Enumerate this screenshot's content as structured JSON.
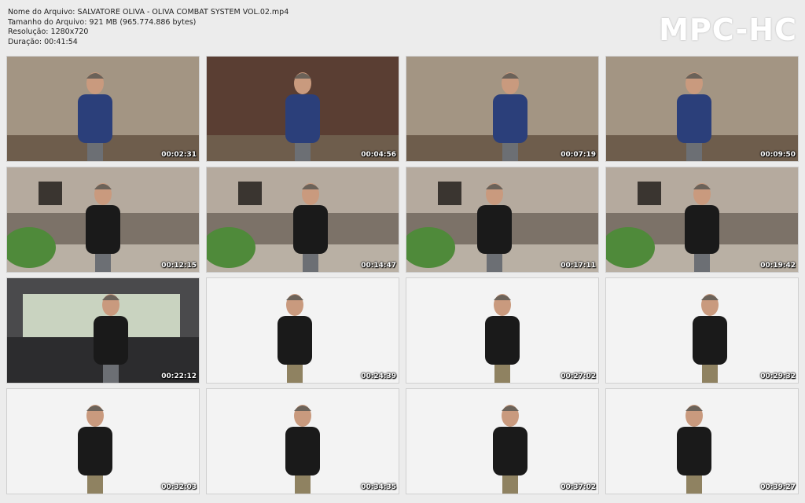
{
  "file_info": {
    "name": "Nome do Arquivo: SALVATORE OLIVA - OLIVA COMBAT SYSTEM VOL.02.mp4",
    "size": "Tamanho do Arquivo: 921 MB (965.774.886 bytes)",
    "resolution": "Resolução: 1280x720",
    "duration": "Duração: 00:41:54"
  },
  "logo": "MPC-HC",
  "colors": {
    "page_background": "#ececec",
    "timestamp_text": "#ffffff"
  },
  "thumbnails": [
    {
      "timestamp": "00:02:31",
      "scene": "indoor-room"
    },
    {
      "timestamp": "00:04:56",
      "scene": "indoor-studio"
    },
    {
      "timestamp": "00:07:19",
      "scene": "indoor-room"
    },
    {
      "timestamp": "00:09:50",
      "scene": "indoor-room"
    },
    {
      "timestamp": "00:12:15",
      "scene": "outdoor-fence"
    },
    {
      "timestamp": "00:14:47",
      "scene": "outdoor-fence"
    },
    {
      "timestamp": "00:17:11",
      "scene": "outdoor-fence"
    },
    {
      "timestamp": "00:19:42",
      "scene": "outdoor-fence"
    },
    {
      "timestamp": "00:22:12",
      "scene": "car-interior"
    },
    {
      "timestamp": "00:24:39",
      "scene": "white-studio"
    },
    {
      "timestamp": "00:27:02",
      "scene": "white-studio"
    },
    {
      "timestamp": "00:29:32",
      "scene": "white-studio"
    },
    {
      "timestamp": "00:32:03",
      "scene": "white-studio"
    },
    {
      "timestamp": "00:34:35",
      "scene": "white-studio"
    },
    {
      "timestamp": "00:37:02",
      "scene": "white-studio"
    },
    {
      "timestamp": "00:39:27",
      "scene": "white-studio"
    }
  ]
}
